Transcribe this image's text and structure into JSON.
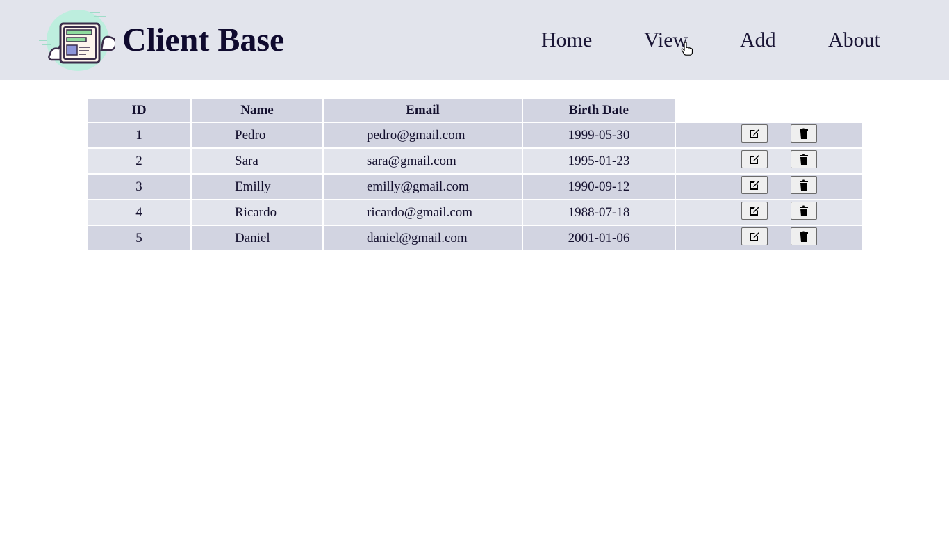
{
  "header": {
    "brand": "Client Base",
    "nav": [
      "Home",
      "View",
      "Add",
      "About"
    ]
  },
  "table": {
    "columns": [
      "ID",
      "Name",
      "Email",
      "Birth Date"
    ],
    "rows": [
      {
        "id": "1",
        "name": "Pedro",
        "email": "pedro@gmail.com",
        "birth": "1999-05-30"
      },
      {
        "id": "2",
        "name": "Sara",
        "email": "sara@gmail.com",
        "birth": "1995-01-23"
      },
      {
        "id": "3",
        "name": "Emilly",
        "email": "emilly@gmail.com",
        "birth": "1990-09-12"
      },
      {
        "id": "4",
        "name": "Ricardo",
        "email": "ricardo@gmail.com",
        "birth": "1988-07-18"
      },
      {
        "id": "5",
        "name": "Daniel",
        "email": "daniel@gmail.com",
        "birth": "2001-01-06"
      }
    ],
    "row_actions": [
      "edit-icon",
      "trash-icon"
    ]
  },
  "colors": {
    "header_bg": "#e2e4ec",
    "row_odd": "#d2d4e1",
    "row_even": "#e2e4ec",
    "text": "#14102e"
  }
}
